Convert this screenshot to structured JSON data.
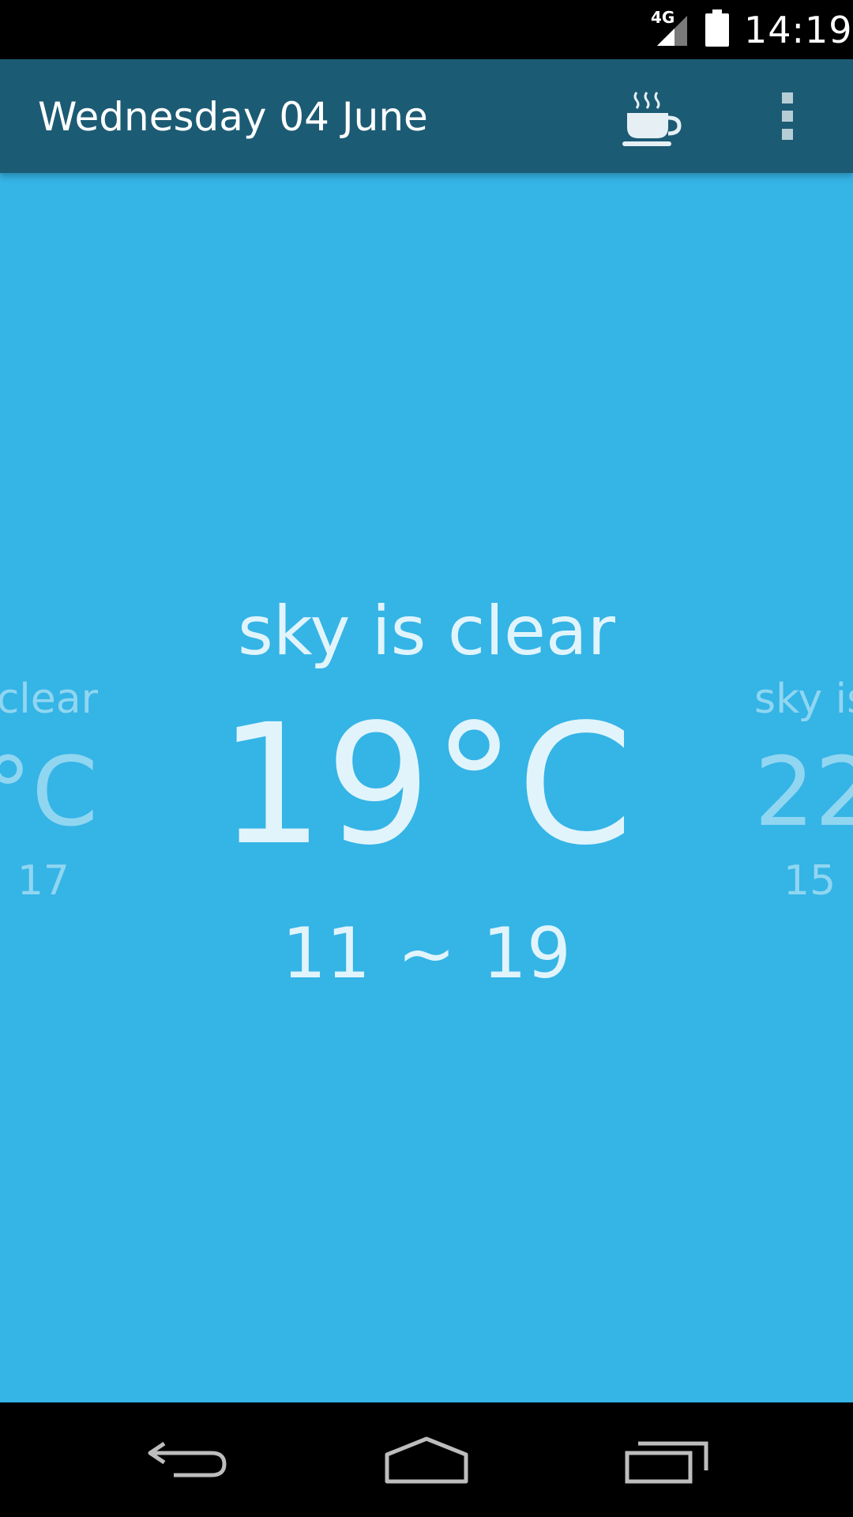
{
  "status_bar": {
    "network_label": "4G",
    "time": "14:19",
    "icons": [
      "signal-icon",
      "battery-icon"
    ]
  },
  "action_bar": {
    "title": "Wednesday 04 June",
    "icons": [
      "coffee-cup-icon",
      "overflow-menu-icon"
    ],
    "background_color": "#1c5b74"
  },
  "weather": {
    "background_color": "#35b4e6",
    "pages": {
      "previous": {
        "description": "clear",
        "temperature": "°C",
        "range": "~ 17"
      },
      "current": {
        "description": "sky is clear",
        "temperature": "19°C",
        "range": "11 ~ 19"
      },
      "next": {
        "description": "sky is",
        "temperature": "22",
        "range": "15 ~"
      }
    }
  },
  "navigation_bar": {
    "icons": [
      "back-icon",
      "home-icon",
      "recents-icon"
    ]
  }
}
